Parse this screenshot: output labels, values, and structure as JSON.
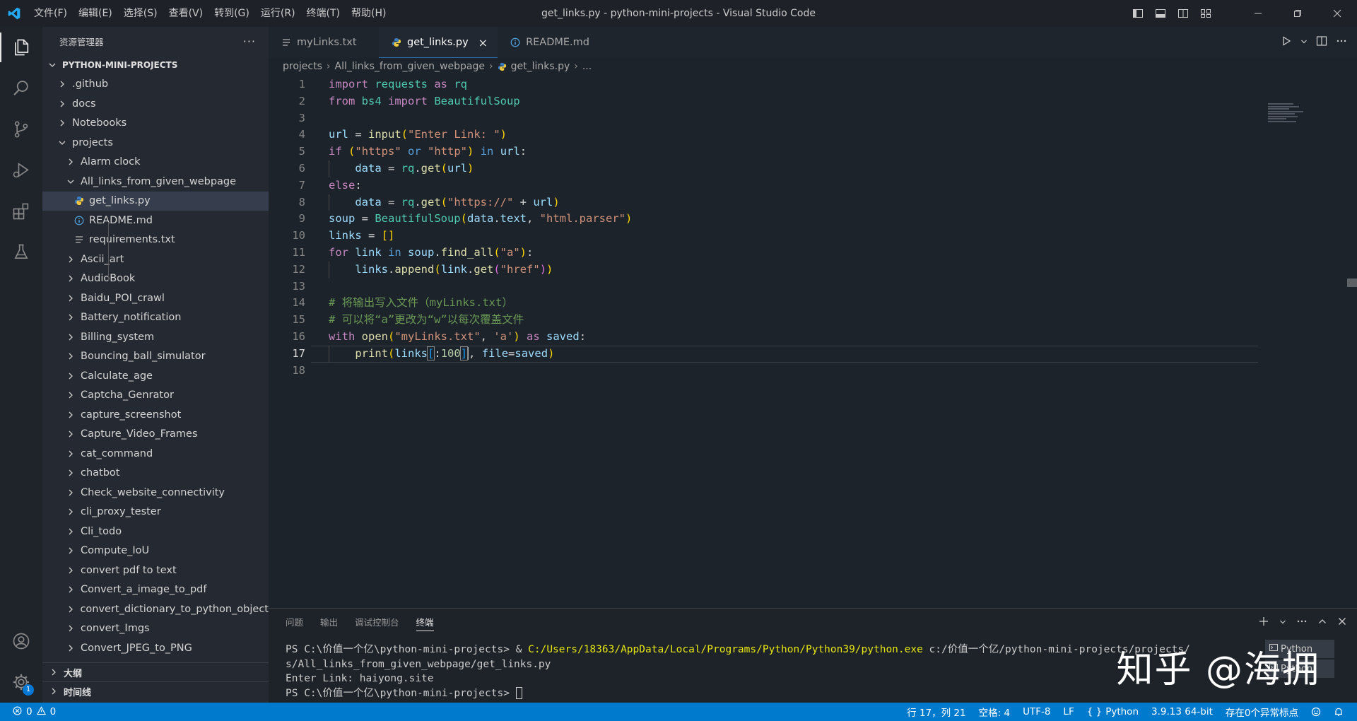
{
  "window": {
    "title": "get_links.py - python-mini-projects - Visual Studio Code"
  },
  "menu": {
    "items": [
      "文件(F)",
      "编辑(E)",
      "选择(S)",
      "查看(V)",
      "转到(G)",
      "运行(R)",
      "终端(T)",
      "帮助(H)"
    ]
  },
  "sidebar": {
    "title": "资源管理器",
    "more": "···",
    "root": "PYTHON-MINI-PROJECTS",
    "tree": [
      {
        "label": ".github",
        "depth": 1,
        "type": "folder",
        "expanded": false
      },
      {
        "label": "docs",
        "depth": 1,
        "type": "folder",
        "expanded": false
      },
      {
        "label": "Notebooks",
        "depth": 1,
        "type": "folder",
        "expanded": false
      },
      {
        "label": "projects",
        "depth": 1,
        "type": "folder",
        "expanded": true
      },
      {
        "label": "Alarm clock",
        "depth": 2,
        "type": "folder",
        "expanded": false
      },
      {
        "label": "All_links_from_given_webpage",
        "depth": 2,
        "type": "folder",
        "expanded": true
      },
      {
        "label": "get_links.py",
        "depth": 3,
        "type": "python",
        "selected": true
      },
      {
        "label": "README.md",
        "depth": 3,
        "type": "info"
      },
      {
        "label": "requirements.txt",
        "depth": 3,
        "type": "text"
      },
      {
        "label": "Ascii_art",
        "depth": 2,
        "type": "folder",
        "expanded": false
      },
      {
        "label": "AudioBook",
        "depth": 2,
        "type": "folder",
        "expanded": false
      },
      {
        "label": "Baidu_POI_crawl",
        "depth": 2,
        "type": "folder",
        "expanded": false
      },
      {
        "label": "Battery_notification",
        "depth": 2,
        "type": "folder",
        "expanded": false
      },
      {
        "label": "Billing_system",
        "depth": 2,
        "type": "folder",
        "expanded": false
      },
      {
        "label": "Bouncing_ball_simulator",
        "depth": 2,
        "type": "folder",
        "expanded": false
      },
      {
        "label": "Calculate_age",
        "depth": 2,
        "type": "folder",
        "expanded": false
      },
      {
        "label": "Captcha_Genrator",
        "depth": 2,
        "type": "folder",
        "expanded": false
      },
      {
        "label": "capture_screenshot",
        "depth": 2,
        "type": "folder",
        "expanded": false
      },
      {
        "label": "Capture_Video_Frames",
        "depth": 2,
        "type": "folder",
        "expanded": false
      },
      {
        "label": "cat_command",
        "depth": 2,
        "type": "folder",
        "expanded": false
      },
      {
        "label": "chatbot",
        "depth": 2,
        "type": "folder",
        "expanded": false
      },
      {
        "label": "Check_website_connectivity",
        "depth": 2,
        "type": "folder",
        "expanded": false
      },
      {
        "label": "cli_proxy_tester",
        "depth": 2,
        "type": "folder",
        "expanded": false
      },
      {
        "label": "Cli_todo",
        "depth": 2,
        "type": "folder",
        "expanded": false
      },
      {
        "label": "Compute_IoU",
        "depth": 2,
        "type": "folder",
        "expanded": false
      },
      {
        "label": "convert pdf to text",
        "depth": 2,
        "type": "folder",
        "expanded": false
      },
      {
        "label": "Convert_a_image_to_pdf",
        "depth": 2,
        "type": "folder",
        "expanded": false
      },
      {
        "label": "convert_dictionary_to_python_object",
        "depth": 2,
        "type": "folder",
        "expanded": false
      },
      {
        "label": "convert_Imgs",
        "depth": 2,
        "type": "folder",
        "expanded": false
      },
      {
        "label": "Convert_JPEG_to_PNG",
        "depth": 2,
        "type": "folder",
        "expanded": false
      }
    ],
    "outline": "大纲",
    "timeline": "时间线"
  },
  "editor": {
    "tabs": [
      {
        "label": "myLinks.txt",
        "icon": "text-file-icon",
        "active": false
      },
      {
        "label": "get_links.py",
        "icon": "python-icon",
        "active": true
      },
      {
        "label": "README.md",
        "icon": "info-icon",
        "active": false
      }
    ],
    "tab_close": "×",
    "breadcrumb": [
      "projects",
      "All_links_from_given_webpage",
      "get_links.py",
      "..."
    ],
    "current_line": 17,
    "code_lines": [
      [
        [
          "import",
          "kw"
        ],
        [
          " requests ",
          "cls"
        ],
        [
          "as",
          "kw"
        ],
        [
          " rq",
          "cls"
        ]
      ],
      [
        [
          "from",
          "kw"
        ],
        [
          " bs4 ",
          "cls"
        ],
        [
          "import",
          "kw"
        ],
        [
          " BeautifulSoup",
          "cls"
        ]
      ],
      [],
      [
        [
          "url",
          "var"
        ],
        [
          " = ",
          ""
        ],
        [
          "input",
          "fn"
        ],
        [
          "(",
          "brk"
        ],
        [
          "\"Enter Link: \"",
          "str"
        ],
        [
          ")",
          "brk"
        ]
      ],
      [
        [
          "if",
          "kw"
        ],
        [
          " ",
          ""
        ],
        [
          "(",
          "brk"
        ],
        [
          "\"https\"",
          "str"
        ],
        [
          " or ",
          "kw2"
        ],
        [
          "\"http\"",
          "str"
        ],
        [
          ")",
          "brk"
        ],
        [
          " in ",
          "kw2"
        ],
        [
          "url",
          "var"
        ],
        [
          ":",
          ""
        ]
      ],
      [
        [
          "    ",
          ""
        ],
        [
          "data",
          "var"
        ],
        [
          " = ",
          ""
        ],
        [
          "rq",
          "cls"
        ],
        [
          ".",
          ""
        ],
        [
          "get",
          "fn"
        ],
        [
          "(",
          "brk"
        ],
        [
          "url",
          "var"
        ],
        [
          ")",
          "brk"
        ]
      ],
      [
        [
          "else",
          "kw"
        ],
        [
          ":",
          ""
        ]
      ],
      [
        [
          "    ",
          ""
        ],
        [
          "data",
          "var"
        ],
        [
          " = ",
          ""
        ],
        [
          "rq",
          "cls"
        ],
        [
          ".",
          ""
        ],
        [
          "get",
          "fn"
        ],
        [
          "(",
          "brk"
        ],
        [
          "\"https://\"",
          "str"
        ],
        [
          " + ",
          ""
        ],
        [
          "url",
          "var"
        ],
        [
          ")",
          "brk"
        ]
      ],
      [
        [
          "soup",
          "var"
        ],
        [
          " = ",
          ""
        ],
        [
          "BeautifulSoup",
          "cls"
        ],
        [
          "(",
          "brk"
        ],
        [
          "data",
          "var"
        ],
        [
          ".",
          ""
        ],
        [
          "text",
          "var"
        ],
        [
          ", ",
          ""
        ],
        [
          "\"html.parser\"",
          "str"
        ],
        [
          ")",
          "brk"
        ]
      ],
      [
        [
          "links",
          "var"
        ],
        [
          " = ",
          ""
        ],
        [
          "[]",
          "brk"
        ]
      ],
      [
        [
          "for",
          "kw"
        ],
        [
          " ",
          ""
        ],
        [
          "link",
          "var"
        ],
        [
          " in ",
          "kw2"
        ],
        [
          "soup",
          "var"
        ],
        [
          ".",
          ""
        ],
        [
          "find_all",
          "fn"
        ],
        [
          "(",
          "brk"
        ],
        [
          "\"a\"",
          "str"
        ],
        [
          ")",
          "brk"
        ],
        [
          ":",
          ""
        ]
      ],
      [
        [
          "    ",
          ""
        ],
        [
          "links",
          "var"
        ],
        [
          ".",
          ""
        ],
        [
          "append",
          "fn"
        ],
        [
          "(",
          "brk"
        ],
        [
          "link",
          "var"
        ],
        [
          ".",
          ""
        ],
        [
          "get",
          "fn"
        ],
        [
          "(",
          "brk2"
        ],
        [
          "\"href\"",
          "str"
        ],
        [
          ")",
          "brk2"
        ],
        [
          ")",
          "brk"
        ]
      ],
      [],
      [
        [
          "# 将输出写入文件（myLinks.txt）",
          "cmt"
        ]
      ],
      [
        [
          "# 可以将“a”更改为“w”以每次覆盖文件",
          "cmt"
        ]
      ],
      [
        [
          "with",
          "kw"
        ],
        [
          " ",
          ""
        ],
        [
          "open",
          "fn"
        ],
        [
          "(",
          "brk"
        ],
        [
          "\"myLinks.txt\"",
          "str"
        ],
        [
          ", ",
          ""
        ],
        [
          "'a'",
          "str"
        ],
        [
          ")",
          "brk"
        ],
        [
          " as ",
          "kw"
        ],
        [
          "saved",
          "var"
        ],
        [
          ":",
          ""
        ]
      ],
      [
        [
          "    ",
          ""
        ],
        [
          "print",
          "fn"
        ],
        [
          "(",
          "brk"
        ],
        [
          "links",
          "var"
        ],
        [
          "[",
          "brk3 br-hl"
        ],
        [
          ":",
          ""
        ],
        [
          "100",
          "num"
        ],
        [
          "]",
          "brk3 br-hl"
        ],
        [
          "CURSOR",
          ""
        ],
        [
          ", ",
          ""
        ],
        [
          "file",
          "var"
        ],
        [
          "=",
          ""
        ],
        [
          "saved",
          "var"
        ],
        [
          ")",
          "brk"
        ]
      ],
      []
    ]
  },
  "panel": {
    "tabs": [
      {
        "label": "问题",
        "active": false
      },
      {
        "label": "输出",
        "active": false
      },
      {
        "label": "调试控制台",
        "active": false
      },
      {
        "label": "终端",
        "active": true
      }
    ],
    "terminal": {
      "line1_prompt": "PS C:\\价值一个亿\\python-mini-projects> & ",
      "line1_exe": "C:/Users/18363/AppData/Local/Programs/Python/Python39/python.exe",
      "line1_arg": " c:/价值一个亿/python-mini-projects/projects/",
      "line2": "s/All_links_from_given_webpage/get_links.py",
      "line3": "Enter Link: haiyong.site",
      "line4": "PS C:\\价值一个亿\\python-mini-projects> "
    },
    "terminal_list": [
      "Python",
      "Python"
    ],
    "watermark": "知乎 @海拥"
  },
  "status": {
    "errors": "0",
    "warnings": "0",
    "position": "行 17，列 21",
    "spaces": "空格: 4",
    "encoding": "UTF-8",
    "eol": "LF",
    "language": "Python",
    "interpreter": "3.9.13 64-bit",
    "exceptions": "存在0个异常标点"
  },
  "accounts_badge": "1",
  "colors": {
    "accent": "#007acc",
    "vscode_blue": "#23a9f2"
  }
}
